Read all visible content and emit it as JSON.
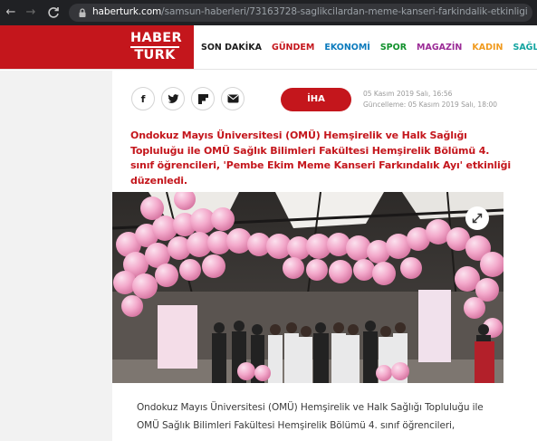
{
  "browser": {
    "nav": {
      "back": "←",
      "forward": "→",
      "reload": "C"
    },
    "url_domain": "haberturk.com",
    "url_path": "/samsun-haberleri/73163728-saglikcilardan-meme-kanseri-farkindalik-etkinligi"
  },
  "site": {
    "logo_top": "HABER",
    "logo_bottom": "TURK",
    "brand_color": "#c4161c",
    "menu": [
      {
        "label": "SON DAKİKA",
        "color": "#1b1b1b"
      },
      {
        "label": "GÜNDEM",
        "color": "#c4161c"
      },
      {
        "label": "EKONOMİ",
        "color": "#0c7bbd"
      },
      {
        "label": "SPOR",
        "color": "#11912c"
      },
      {
        "label": "MAGAZİN",
        "color": "#9b2b96"
      },
      {
        "label": "KADIN",
        "color": "#f09a1e"
      },
      {
        "label": "SAĞLIK",
        "color": "#12a4a0"
      }
    ]
  },
  "article": {
    "share": [
      {
        "icon": "facebook-icon",
        "glyph": "f"
      },
      {
        "icon": "twitter-icon",
        "glyph": ""
      },
      {
        "icon": "flipboard-icon",
        "glyph": ""
      },
      {
        "icon": "email-icon",
        "glyph": ""
      }
    ],
    "source": "İHA",
    "published": "05 Kasım 2019 Salı, 16:56",
    "updated": "Güncelleme: 05 Kasım 2019 Salı, 18:00",
    "lede": "Ondokuz Mayıs Üniversitesi (OMÜ) Hemşirelik ve Halk Sağlığı Topluluğu ile OMÜ Sağlık Bilimleri Fakültesi Hemşirelik Bölümü 4. sınıf öğrencileri, 'Pembe Ekim Meme Kanseri Farkındalık Ayı' etkinliği düzenledi.",
    "body_lines": [
      "Ondokuz Mayıs Üniversitesi (OMÜ) Hemşirelik ve Halk Sağlığı Topluluğu ile",
      "OMÜ Sağlık Bilimleri Fakültesi Hemşirelik Bölümü 4. sınıf öğrencileri,"
    ]
  }
}
